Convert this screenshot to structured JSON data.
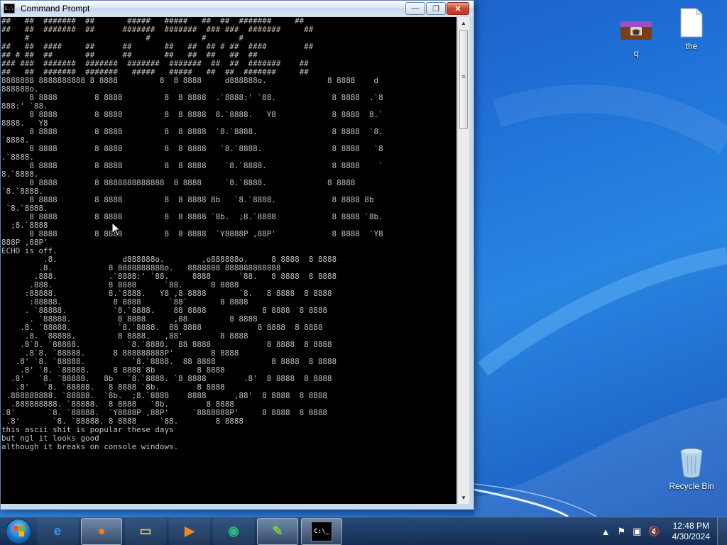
{
  "window": {
    "title": "Command Prompt",
    "minimize_label": "—",
    "maximize_label": "❐",
    "close_label": "✕"
  },
  "console": {
    "lines": [
      "##   ##  #######  ##       #####   #####   ##  ##  #######     ##",
      "##   ##  #######  ##      #######  #######  ### ###  #######     ##",
      "     #                         #           #       #",
      "##   ##  ####     ##      ##       ##   ##  ## # ##  ####        ##",
      "## # ##  ##       ##      ##       ##   ##  ##   ##  ##",
      "### ###  #######  #######  #######  #######  ##  ##  #######    ##",
      "##   ##  #######  #######   #####   #####   ##  ##  #######     ##",
      "8888888 8888888888 8 8888         8  8 8888     d888888o.             8 8888    d",
      "888888o.",
      "      8 8888        8 8888         8  8 8888  .`8888:' `88.            8 8888  .`8",
      "888:' `88.",
      "      8 8888        8 8888         8  8 8888  8.`8888.   Y8            8 8888  8.`",
      "8888.   Y8",
      "      8 8888        8 8888         8  8 8888  `8.`8888.                8 8888  `8.",
      "`8888.",
      "      8 8888        8 8888         8  8 8888   `8.`8888.               8 8888   `8",
      ".`8888.",
      "      8 8888        8 8888         8  8 8888    `8.`8888.              8 8888    `",
      "8.`8888.",
      "      8 8888        8 8888888888888  8 8888     `8.`8888.             8 8888",
      "`8.`8888.",
      "      8 8888        8 8888         8  8 8888 8b   `8.`8888.            8 8888 8b",
      " `8.`8888.",
      "      8 8888        8 8888         8  8 8888 `8b.  ;8.`8888            8 8888 `8b.",
      "  ;8.`8888",
      "      8 8888        8 8888         8  8 8888  `Y8888P ,88P'            8 8888  `Y8",
      "888P ,88P'",
      "ECHO is off.",
      "         .8.              d888888o.        ,o888888o.     8 8888  8 8888",
      "        .8.            8 8888888888o.   8888888 888888888888",
      "       .888.           .`8888:' `88.     8888      `88.   8 8888  8 8888",
      "      .888.            8 8888      `88.      8 8888",
      "     :88888.           8.`8888.   Y8 ,8 8888       `8.   8 8888  8 8888",
      "      :88888.           8 8888      `88`       8 8888",
      "     . `88888.          `8.`8888.    88 8888            8 8888  8 8888",
      "      . `88888.          8 8888      ,88         8 8888",
      "    .8. `88888.          `8.`8888.  88 8888            8 8888  8 8888",
      "     .8. `88888.         8 8888.   ,88'        8 8888",
      "    .8`8. `88888.          `8.`8888.  88 8888            8 8888  8 8888",
      "     .8`8. `88888.      8 888888888P'        8 8888",
      "   .8' `8. `88888.          `8.`8888.  88 8888            8 8888  8 8888",
      "    .8' `8. `88888.     8 8888`8b         8 8888",
      "  .8'   `8. `88888.   8b   `8.`8888. `8 8888        .8'  8 8888  8 8888",
      "   .8'   `8. `88888.   8 8888 `8b.        8 8888",
      " .888888888. `88888.  `8b.  ;8.`8888    8888      ,88'  8 8888  8 8888",
      "  .888888888. `88888.  8 8888   `8b.        8 8888",
      ".8'       `8. `88888.  `Y8888P ,88P'     `8888888P'     8 8888  8 8888",
      " .8'       `8. `88888. 8 8888     `88.        8 8888",
      "this ascii shit is popular these days",
      "but ngl it looks good",
      "although it breaks on console windows."
    ]
  },
  "desktop_icons": [
    {
      "label": "q",
      "kind": "phone-dialer-icon"
    },
    {
      "label": "the",
      "kind": "text-file-icon"
    },
    {
      "label": "Recycle Bin",
      "kind": "recycle-bin-icon"
    }
  ],
  "taskbar": {
    "items": [
      {
        "name": "internet-explorer",
        "glyph": "e",
        "color": "#3a9ae8"
      },
      {
        "name": "firefox",
        "glyph": "●",
        "color": "#ff7a1a"
      },
      {
        "name": "file-explorer",
        "glyph": "▭",
        "color": "#f2c24e"
      },
      {
        "name": "media-player",
        "glyph": "▶",
        "color": "#f08a24"
      },
      {
        "name": "network-app",
        "glyph": "◉",
        "color": "#2fb87a"
      },
      {
        "name": "notepad-plus",
        "glyph": "✎",
        "color": "#7ec843"
      },
      {
        "name": "command-prompt",
        "glyph": "C:\\_",
        "color": "#dddddd"
      }
    ],
    "clock_time": "12:48 PM",
    "clock_date": "4/30/2024"
  },
  "colors": {
    "console_bg": "#000000",
    "console_fg": "#c0c0c0",
    "desktop_blue": "#1e6fd6"
  }
}
